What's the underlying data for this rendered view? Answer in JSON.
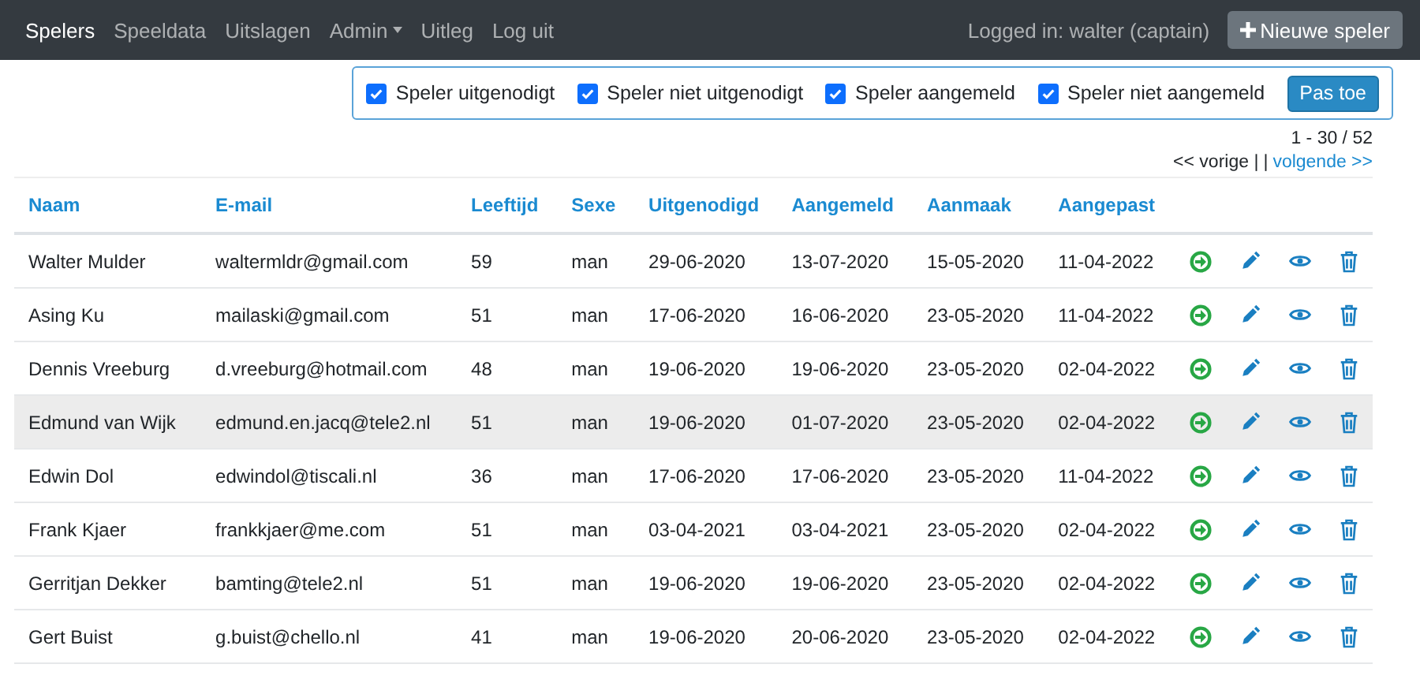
{
  "navbar": {
    "items": [
      {
        "label": "Spelers",
        "selected": true,
        "dropdown": false
      },
      {
        "label": "Speeldata",
        "selected": false,
        "dropdown": false
      },
      {
        "label": "Uitslagen",
        "selected": false,
        "dropdown": false
      },
      {
        "label": "Admin",
        "selected": false,
        "dropdown": true
      },
      {
        "label": "Uitleg",
        "selected": false,
        "dropdown": false
      },
      {
        "label": "Log uit",
        "selected": false,
        "dropdown": false
      }
    ],
    "user": "Logged in: walter (captain)",
    "new_button": "Nieuwe speler"
  },
  "filters": {
    "options": [
      {
        "label": "Speler uitgenodigt",
        "checked": true
      },
      {
        "label": "Speler niet uitgenodigt",
        "checked": true
      },
      {
        "label": "Speler aangemeld",
        "checked": true
      },
      {
        "label": "Speler niet aangemeld",
        "checked": true
      }
    ],
    "apply_button": "Pas toe"
  },
  "pagination": {
    "range": "1 - 30 / 52",
    "previous": "<< vorige |",
    "separator": "|",
    "next": "volgende >>"
  },
  "table": {
    "columns": [
      "Naam",
      "E-mail",
      "Leeftijd",
      "Sexe",
      "Uitgenodigd",
      "Aangemeld",
      "Aanmaak",
      "Aangepast"
    ],
    "rows": [
      {
        "cells": [
          "Walter Mulder",
          "waltermldr@gmail.com",
          "59",
          "man",
          "29-06-2020",
          "13-07-2020",
          "15-05-2020",
          "11-04-2022"
        ],
        "selected": false
      },
      {
        "cells": [
          "Asing Ku",
          "mailaski@gmail.com",
          "51",
          "man",
          "17-06-2020",
          "16-06-2020",
          "23-05-2020",
          "11-04-2022"
        ],
        "selected": false
      },
      {
        "cells": [
          "Dennis Vreeburg",
          "d.vreeburg@hotmail.com",
          "48",
          "man",
          "19-06-2020",
          "19-06-2020",
          "23-05-2020",
          "02-04-2022"
        ],
        "selected": false
      },
      {
        "cells": [
          "Edmund van Wijk",
          "edmund.en.jacq@tele2.nl",
          "51",
          "man",
          "19-06-2020",
          "01-07-2020",
          "23-05-2020",
          "02-04-2022"
        ],
        "selected": true
      },
      {
        "cells": [
          "Edwin Dol",
          "edwindol@tiscali.nl",
          "36",
          "man",
          "17-06-2020",
          "17-06-2020",
          "23-05-2020",
          "11-04-2022"
        ],
        "selected": false
      },
      {
        "cells": [
          "Frank Kjaer",
          "frankkjaer@me.com",
          "51",
          "man",
          "03-04-2021",
          "03-04-2021",
          "23-05-2020",
          "02-04-2022"
        ],
        "selected": false
      },
      {
        "cells": [
          "Gerritjan Dekker",
          "bamting@tele2.nl",
          "51",
          "man",
          "19-06-2020",
          "19-06-2020",
          "23-05-2020",
          "02-04-2022"
        ],
        "selected": false
      },
      {
        "cells": [
          "Gert Buist",
          "g.buist@chello.nl",
          "41",
          "man",
          "19-06-2020",
          "20-06-2020",
          "23-05-2020",
          "02-04-2022"
        ],
        "selected": false
      }
    ]
  }
}
